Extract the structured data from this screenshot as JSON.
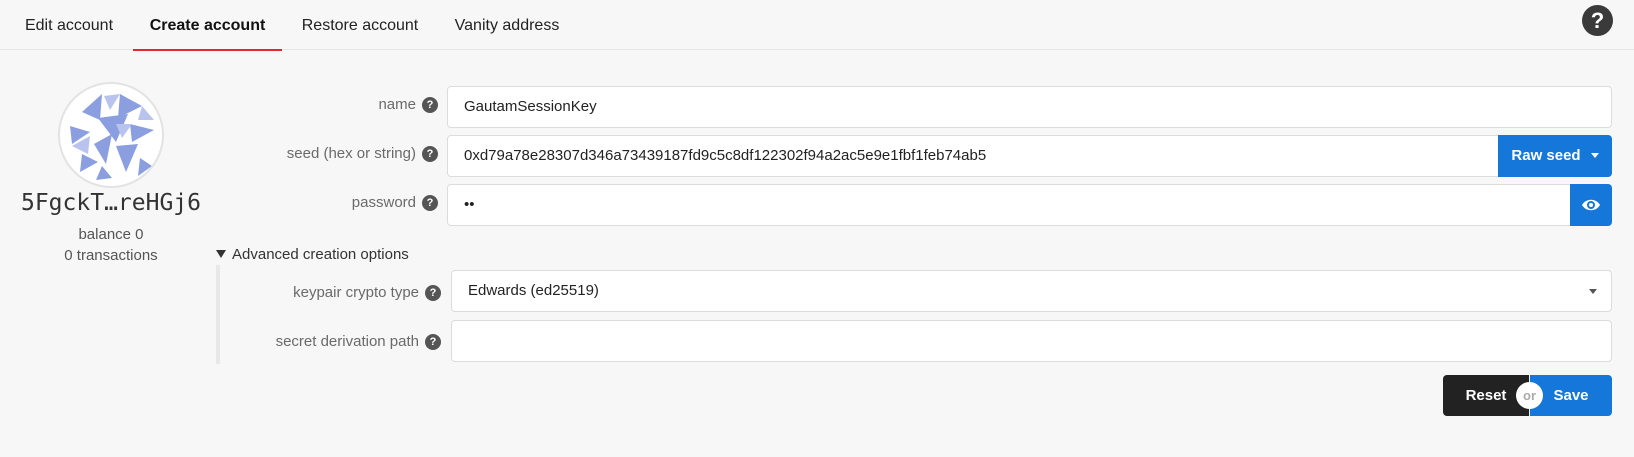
{
  "tabs": [
    {
      "label": "Edit account"
    },
    {
      "label": "Create account"
    },
    {
      "label": "Restore account"
    },
    {
      "label": "Vanity address"
    }
  ],
  "help_icon": {
    "glyph": "?"
  },
  "account": {
    "address_short": "5FgckT…reHGj6",
    "balance": "balance 0",
    "transactions": "0 transactions"
  },
  "form": {
    "name": {
      "label": "name",
      "value": "GautamSessionKey"
    },
    "seed": {
      "label": "seed (hex or string)",
      "value": "0xd79a78e28307d346a73439187fd9c5c8df122302f94a2ac5e9e1fbf1feb74ab5",
      "type_button": "Raw seed"
    },
    "password": {
      "label": "password",
      "value": "••"
    },
    "advanced": {
      "toggle_label": "Advanced creation options",
      "crypto": {
        "label": "keypair crypto type",
        "value": "Edwards (ed25519)"
      },
      "derivation": {
        "label": "secret derivation path",
        "value": ""
      }
    }
  },
  "actions": {
    "reset": "Reset",
    "or": "or",
    "save": "Save"
  },
  "colors": {
    "accent": "#1577d9",
    "active_tab": "#e32a2a",
    "dark": "#222222"
  }
}
